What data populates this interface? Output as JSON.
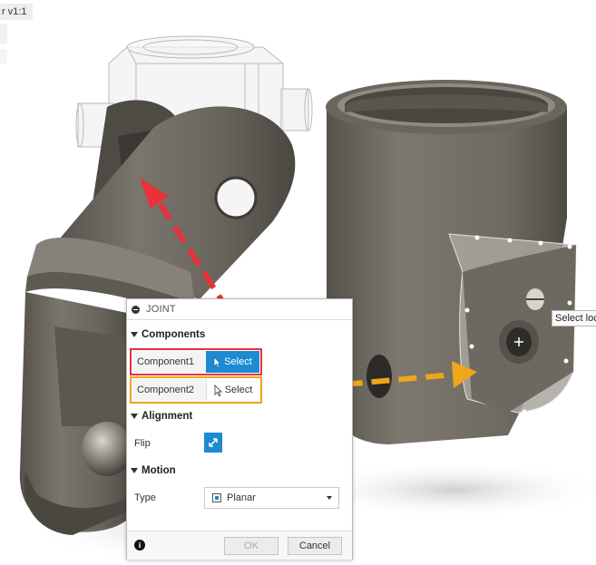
{
  "document": {
    "title": "r v1:1"
  },
  "tooltip": {
    "text": "Select loca"
  },
  "dialog": {
    "title": "JOINT",
    "sections": {
      "components": {
        "label": "Components",
        "component1": {
          "label": "Component1",
          "button": "Select"
        },
        "component2": {
          "label": "Component2",
          "button": "Select"
        }
      },
      "alignment": {
        "label": "Alignment",
        "flip_label": "Flip"
      },
      "motion": {
        "label": "Motion",
        "type_label": "Type",
        "type_value": "Planar"
      }
    },
    "footer": {
      "ok": "OK",
      "cancel": "Cancel"
    }
  },
  "colors": {
    "accent": "#1e8ad2",
    "highlight_red": "#e8323a",
    "highlight_orange": "#efa51c",
    "model_gray": "#6b675f"
  },
  "icons": [
    "info-icon",
    "cursor-icon",
    "flip-icon",
    "planar-icon",
    "chevron-down-icon",
    "collapse-icon"
  ]
}
